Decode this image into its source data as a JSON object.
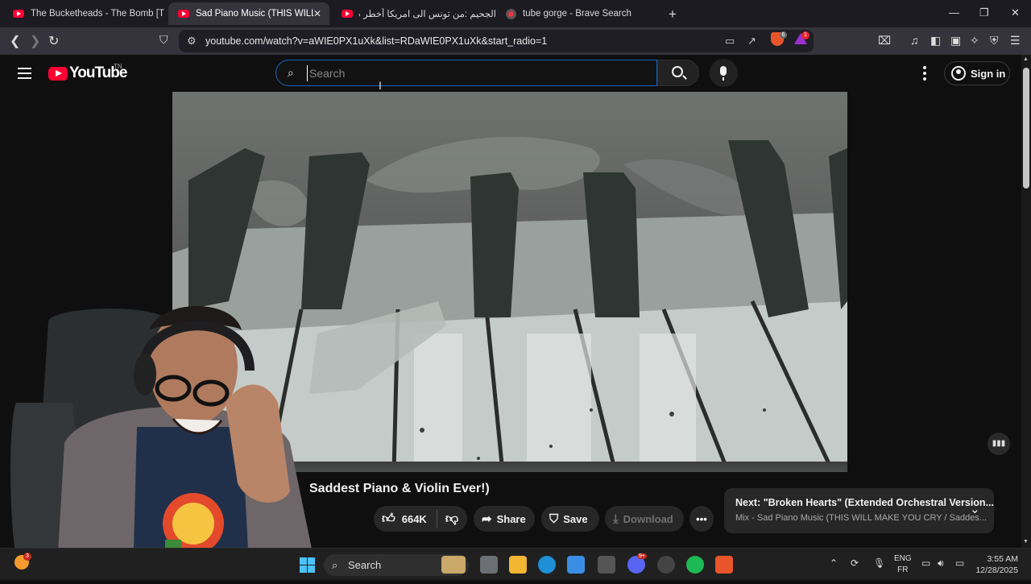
{
  "browser": {
    "tabs": [
      {
        "title": "The Bucketheads - The Bomb [These"
      },
      {
        "title": "Sad Piano Music (THIS WILL MAKE",
        "close": "✕"
      },
      {
        "title": "الجحيم :من تونس الى امريكا أخطر طريق"
      },
      {
        "title": "tube gorge - Brave Search"
      }
    ],
    "new_tab": "+",
    "window_controls": {
      "minimize": "—",
      "maximize": "❐",
      "close": "✕"
    },
    "url": "youtube.com/watch?v=aWIE0PX1uXk&list=RDaWIE0PX1uXk&start_radio=1",
    "shield_badge": "6",
    "rewards_badge": "1"
  },
  "youtube": {
    "logo_text": "YouTube",
    "logo_tm": "TN",
    "search": {
      "placeholder": "Search",
      "value": ""
    },
    "signin_label": "Sign in"
  },
  "video": {
    "title_visible": "Saddest Piano & Violin Ever!)",
    "likes": "664K",
    "share_label": "Share",
    "save_label": "Save",
    "download_label": "Download",
    "next": {
      "title": "Next: \"Broken Hearts\" (Extended Orchestral Version...",
      "subtitle": "Mix - Sad Piano Music (THIS WILL MAKE YOU CRY / Saddes..."
    }
  },
  "taskbar": {
    "weather_badge": "3",
    "search_label": "Search",
    "discord_badge": "9+",
    "language": {
      "line1": "ENG",
      "line2": "FR"
    },
    "time": "3:55 AM",
    "date": "12/28/2025"
  }
}
